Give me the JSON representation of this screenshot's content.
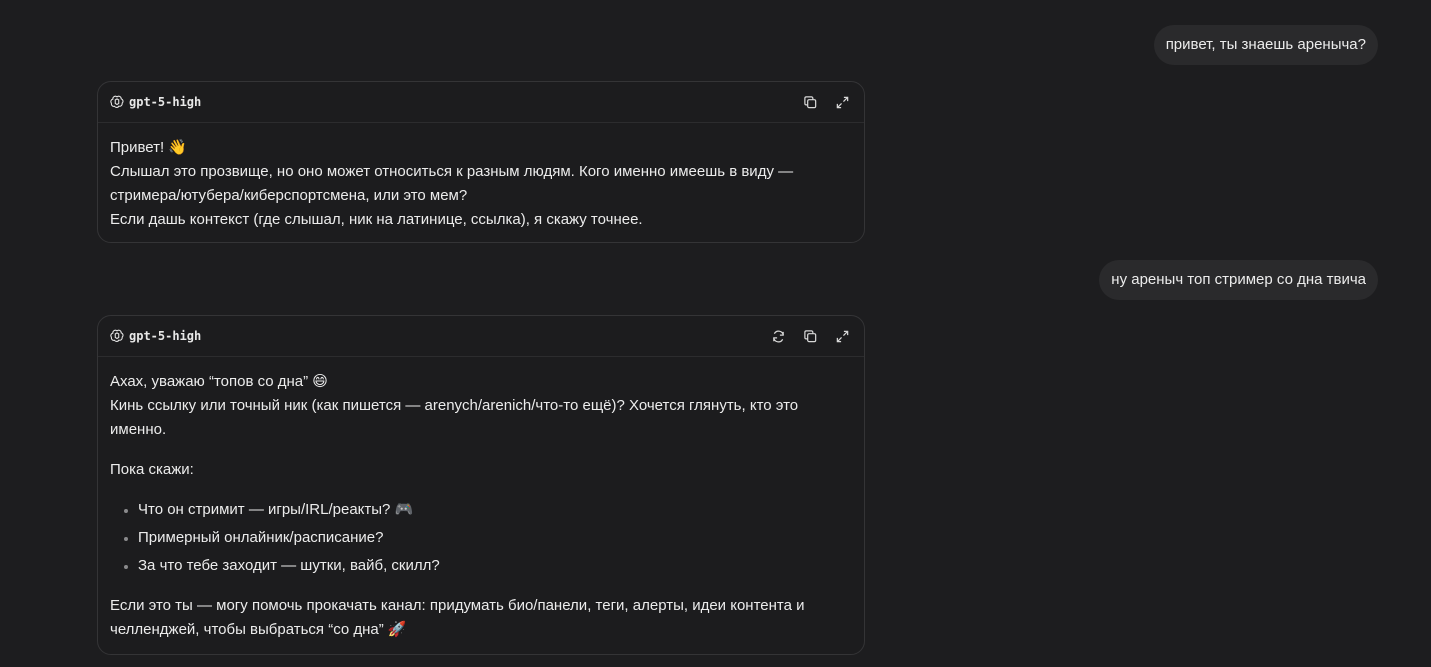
{
  "messages": [
    {
      "role": "user",
      "text": "привет, ты знаешь ареныча?"
    },
    {
      "role": "assistant",
      "model": "gpt-5-high",
      "actions": [
        "copy-icon",
        "expand-icon"
      ],
      "lines": [
        "Привет! 👋",
        "Слышал это прозвище, но оно может относиться к разным людям. Кого именно имеешь в виду —",
        "стримера/ютубера/киберспортсмена, или это мем?",
        "Если дашь контекст (где слышал, ник на латинице, ссылка), я скажу точнее."
      ]
    },
    {
      "role": "user",
      "text": "ну ареныч топ стример со дна твича"
    },
    {
      "role": "assistant",
      "model": "gpt-5-high",
      "actions": [
        "regenerate-icon",
        "copy-icon",
        "expand-icon"
      ],
      "intro": [
        "Ахах, уважаю “топов со дна” 😄",
        "Кинь ссылку или точный ник (как пишется — arenych/arenich/что-то ещё)? Хочется глянуть, кто это",
        "именно."
      ],
      "prompt": "Пока скажи:",
      "bullets": [
        "Что он стримит — игры/IRL/реакты? 🎮",
        "Примерный онлайник/расписание?",
        "За что тебе заходит — шутки, вайб, скилл?"
      ],
      "outro": [
        "Если это ты — могу помочь прокачать канал: придумать био/панели, теги, алерты, идеи контента и",
        "челленджей, чтобы выбраться “со дна” 🚀"
      ]
    }
  ]
}
